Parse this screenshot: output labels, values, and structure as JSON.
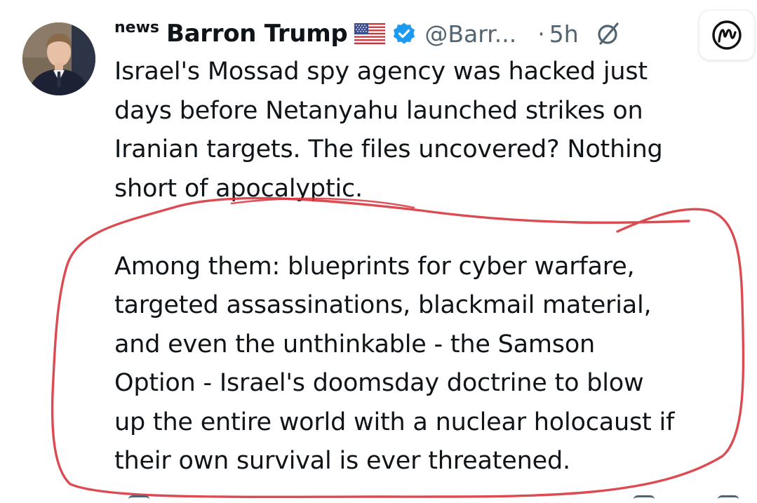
{
  "tweet": {
    "news_tag": "news",
    "display_name": "Barron Trump",
    "flag_icon": "us-flag-icon",
    "verified_icon": "verified-badge-icon",
    "handle": "@Barr...",
    "separator": "·",
    "time": "5h",
    "grok_icon": "slash-circle-icon",
    "extension_icon": "m-logo-icon",
    "body_lines_1": [
      "Israel's Mossad spy agency was hacked just",
      "days before Netanyahu launched strikes on",
      "Iranian targets. The files uncovered? Nothing",
      "short of apocalyptic."
    ],
    "body_lines_2": [
      "Among them: blueprints for cyber warfare,",
      "targeted assassinations, blackmail material,",
      "and even the unthinkable - the Samson",
      "Option - Israel's doomsday doctrine to blow",
      "up the entire world with a nuclear holocaust if",
      "their own survival is ever threatened."
    ]
  },
  "colors": {
    "text": "#0f1419",
    "secondary": "#536471",
    "verified": "#1d9bf0",
    "scribble": "#d8363f"
  }
}
